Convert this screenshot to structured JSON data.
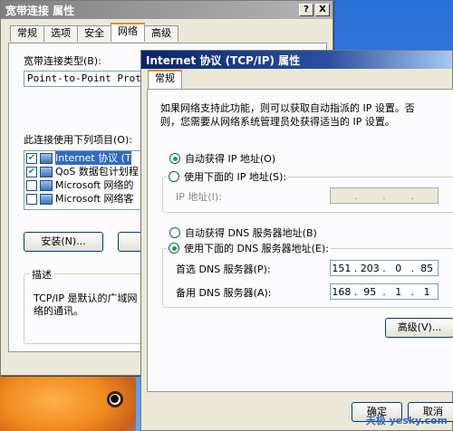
{
  "back_window": {
    "title": "宽带连接 属性",
    "help_btn": "?",
    "close_btn": "X",
    "tabs": [
      "常规",
      "选项",
      "安全",
      "网络",
      "高级"
    ],
    "selected_tab": "网络",
    "type_label": "宽带连接类型(B):",
    "type_value": "Point-to-Point Protocol",
    "items_label": "此连接使用下列项目(O):",
    "items": [
      {
        "label": "Internet 协议 (T",
        "checked": true,
        "selected": true
      },
      {
        "label": "QoS 数据包计划程",
        "checked": true,
        "selected": false
      },
      {
        "label": "Microsoft 网络的",
        "checked": false,
        "selected": false
      },
      {
        "label": "Microsoft 网络客",
        "checked": false,
        "selected": false
      }
    ],
    "install_btn": "安装(N)...",
    "desc_group": "描述",
    "desc_text_1": "TCP/IP 是默认的广域网",
    "desc_text_2": "络的通讯。"
  },
  "front_window": {
    "title": "Internet 协议 (TCP/IP) 属性",
    "tab": "常规",
    "intro_1": "如果网络支持此功能，则可以获取自动指派的 IP 设置。否",
    "intro_2": "则，您需要从网络系统管理员处获得适当的 IP 设置。",
    "auto_ip": "自动获得 IP 地址(O)",
    "manual_ip": "使用下面的 IP 地址(S):",
    "ip_label": "IP 地址(I):",
    "auto_dns": "自动获得 DNS 服务器地址(B)",
    "manual_dns": "使用下面的 DNS 服务器地址(E):",
    "pref_dns_label": "首选 DNS 服务器(P):",
    "pref_dns": [
      "151",
      "203",
      "0",
      "85"
    ],
    "alt_dns_label": "备用 DNS 服务器(A):",
    "alt_dns": [
      "168",
      "95",
      "1",
      "1"
    ],
    "advanced_btn": "高级(V)...",
    "ok_btn": "确定",
    "cancel_btn": "取消"
  },
  "watermark": "天极 yesky.com"
}
